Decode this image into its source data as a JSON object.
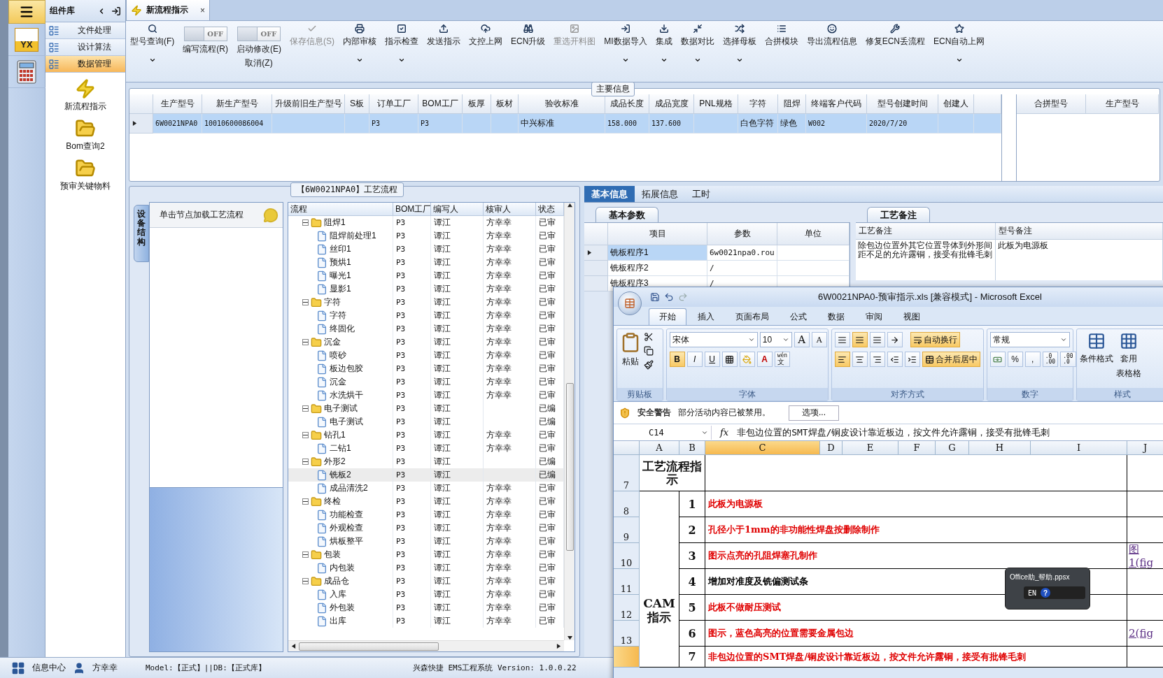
{
  "rail": {
    "logo_text": "YX"
  },
  "component_panel": {
    "title": "组件库",
    "menu": [
      {
        "label": "文件处理",
        "selected": false
      },
      {
        "label": "设计算法",
        "selected": false
      },
      {
        "label": "数据管理",
        "selected": true
      }
    ],
    "items": [
      {
        "kind": "action",
        "label": "新流程指示"
      },
      {
        "kind": "folder",
        "label": "Bom查询2"
      },
      {
        "kind": "folder",
        "label": "预审关键物料"
      }
    ]
  },
  "document_tab": {
    "label": "新流程指示",
    "close": "×"
  },
  "toolbar": [
    {
      "kind": "button",
      "label": "型号查询(F)",
      "dropdown": true,
      "disabled": false
    },
    {
      "kind": "toggle",
      "label": "编写流程(R)",
      "on": false,
      "state_text": "OFF"
    },
    {
      "kind": "toggle",
      "label": "启动修改(E)",
      "sublabel": "取消(Z)",
      "on": false,
      "state_text": "OFF"
    },
    {
      "kind": "button",
      "label": "保存信息(S)",
      "dropdown": false,
      "disabled": true
    },
    {
      "kind": "button",
      "label": "内部审核",
      "dropdown": true,
      "disabled": false
    },
    {
      "kind": "button",
      "label": "指示检查",
      "dropdown": true,
      "disabled": false
    },
    {
      "kind": "button",
      "label": "发送指示",
      "dropdown": false,
      "disabled": false
    },
    {
      "kind": "button",
      "label": "文控上网",
      "dropdown": false,
      "disabled": false
    },
    {
      "kind": "button",
      "label": "ECN升级",
      "dropdown": false,
      "disabled": false
    },
    {
      "kind": "button",
      "label": "重选开料图",
      "dropdown": false,
      "disabled": true
    },
    {
      "kind": "button",
      "label": "MI数据导入",
      "dropdown": true,
      "disabled": false
    },
    {
      "kind": "button",
      "label": "集成",
      "dropdown": true,
      "disabled": false
    },
    {
      "kind": "button",
      "label": "数据对比",
      "dropdown": true,
      "disabled": false
    },
    {
      "kind": "button",
      "label": "选择母板",
      "dropdown": true,
      "disabled": false
    },
    {
      "kind": "button",
      "label": "合拼模块",
      "dropdown": false,
      "disabled": false
    },
    {
      "kind": "button",
      "label": "导出流程信息",
      "dropdown": false,
      "disabled": false
    },
    {
      "kind": "button",
      "label": "修复ECN丢流程",
      "dropdown": false,
      "disabled": false
    },
    {
      "kind": "button",
      "label": "ECN自动上网",
      "dropdown": true,
      "disabled": false
    }
  ],
  "main_info": {
    "title": "主要信息",
    "columns": [
      "生产型号",
      "新生产型号",
      "升级前旧生产型号",
      "S板",
      "订单工厂",
      "BOM工厂",
      "板厚",
      "板材",
      "验收标准",
      "成品长度",
      "成品宽度",
      "PNL规格",
      "字符",
      "阻焊",
      "终端客户代码",
      "型号创建时间",
      "创建人"
    ],
    "rows": [
      {
        "selected": true,
        "cells": [
          "6W0021NPA0",
          "10010600086004",
          null,
          null,
          "P3",
          "P3",
          null,
          null,
          "中兴标准",
          "158.000",
          "137.600",
          null,
          "白色字符",
          "绿色",
          "W002",
          "2020/7/20",
          null
        ]
      }
    ],
    "merge_columns": [
      "合拼型号",
      "生产型号"
    ]
  },
  "process": {
    "title": "【6W0021NPA0】工艺流程",
    "side_tab": "设备结构",
    "hint": "单击节点加载工艺流程",
    "columns": [
      "流程",
      "BOM工厂",
      "编写人",
      "核审人",
      "状态"
    ],
    "tree": [
      {
        "name": "阻焊1",
        "bom": "P3",
        "writer": "谭江",
        "reviewer": "方幸幸",
        "status": "已审",
        "selected": false,
        "expanded": true,
        "children": [
          {
            "name": "阻焊前处理1",
            "bom": "P3",
            "writer": "谭江",
            "reviewer": "方幸幸",
            "status": "已审",
            "selected": false
          },
          {
            "name": "丝印1",
            "bom": "P3",
            "writer": "谭江",
            "reviewer": "方幸幸",
            "status": "已审",
            "selected": false
          },
          {
            "name": "预烘1",
            "bom": "P3",
            "writer": "谭江",
            "reviewer": "方幸幸",
            "status": "已审",
            "selected": false
          },
          {
            "name": "曝光1",
            "bom": "P3",
            "writer": "谭江",
            "reviewer": "方幸幸",
            "status": "已审",
            "selected": false
          },
          {
            "name": "显影1",
            "bom": "P3",
            "writer": "谭江",
            "reviewer": "方幸幸",
            "status": "已审",
            "selected": false
          }
        ]
      },
      {
        "name": "字符",
        "bom": "P3",
        "writer": "谭江",
        "reviewer": "方幸幸",
        "status": "已审",
        "selected": false,
        "expanded": true,
        "children": [
          {
            "name": "字符",
            "bom": "P3",
            "writer": "谭江",
            "reviewer": "方幸幸",
            "status": "已审",
            "selected": false
          },
          {
            "name": "终固化",
            "bom": "P3",
            "writer": "谭江",
            "reviewer": "方幸幸",
            "status": "已审",
            "selected": false
          }
        ]
      },
      {
        "name": "沉金",
        "bom": "P3",
        "writer": "谭江",
        "reviewer": "方幸幸",
        "status": "已审",
        "selected": false,
        "expanded": true,
        "children": [
          {
            "name": "喷砂",
            "bom": "P3",
            "writer": "谭江",
            "reviewer": "方幸幸",
            "status": "已审",
            "selected": false
          },
          {
            "name": "板边包胶",
            "bom": "P3",
            "writer": "谭江",
            "reviewer": "方幸幸",
            "status": "已审",
            "selected": false
          },
          {
            "name": "沉金",
            "bom": "P3",
            "writer": "谭江",
            "reviewer": "方幸幸",
            "status": "已审",
            "selected": false
          },
          {
            "name": "水洗烘干",
            "bom": "P3",
            "writer": "谭江",
            "reviewer": "方幸幸",
            "status": "已审",
            "selected": false
          }
        ]
      },
      {
        "name": "电子测试",
        "bom": "P3",
        "writer": "谭江",
        "status": "已编",
        "selected": false,
        "expanded": true,
        "children": [
          {
            "name": "电子测试",
            "bom": "P3",
            "writer": "谭江",
            "status": "已编",
            "selected": false
          }
        ]
      },
      {
        "name": "钻孔1",
        "bom": "P3",
        "writer": "谭江",
        "reviewer": "方幸幸",
        "status": "已审",
        "selected": false,
        "expanded": true,
        "children": [
          {
            "name": "二钻1",
            "bom": "P3",
            "writer": "谭江",
            "reviewer": "方幸幸",
            "status": "已审",
            "selected": false
          }
        ]
      },
      {
        "name": "外形2",
        "bom": "P3",
        "writer": "谭江",
        "status": "已编",
        "selected": false,
        "expanded": true,
        "children": [
          {
            "name": "铣板2",
            "bom": "P3",
            "writer": "谭江",
            "status": "已编",
            "selected": true
          },
          {
            "name": "成品清洗2",
            "bom": "P3",
            "writer": "谭江",
            "reviewer": "方幸幸",
            "status": "已审",
            "selected": false
          }
        ]
      },
      {
        "name": "终检",
        "bom": "P3",
        "writer": "谭江",
        "reviewer": "方幸幸",
        "status": "已审",
        "selected": false,
        "expanded": true,
        "children": [
          {
            "name": "功能检查",
            "bom": "P3",
            "writer": "谭江",
            "reviewer": "方幸幸",
            "status": "已审",
            "selected": false
          },
          {
            "name": "外观检查",
            "bom": "P3",
            "writer": "谭江",
            "reviewer": "方幸幸",
            "status": "已审",
            "selected": false
          },
          {
            "name": "烘板整平",
            "bom": "P3",
            "writer": "谭江",
            "reviewer": "方幸幸",
            "status": "已审",
            "selected": false
          }
        ]
      },
      {
        "name": "包装",
        "bom": "P3",
        "writer": "谭江",
        "reviewer": "方幸幸",
        "status": "已审",
        "selected": false,
        "expanded": true,
        "children": [
          {
            "name": "内包装",
            "bom": "P3",
            "writer": "谭江",
            "reviewer": "方幸幸",
            "status": "已审",
            "selected": false
          }
        ]
      },
      {
        "name": "成品仓",
        "bom": "P3",
        "writer": "谭江",
        "reviewer": "方幸幸",
        "status": "已审",
        "selected": false,
        "expanded": true,
        "children": [
          {
            "name": "入库",
            "bom": "P3",
            "writer": "谭江",
            "reviewer": "方幸幸",
            "status": "已审",
            "selected": false
          },
          {
            "name": "外包装",
            "bom": "P3",
            "writer": "谭江",
            "reviewer": "方幸幸",
            "status": "已审",
            "selected": false
          },
          {
            "name": "出库",
            "bom": "P3",
            "writer": "谭江",
            "reviewer": "方幸幸",
            "status": "已审",
            "selected": false
          }
        ]
      }
    ]
  },
  "detail": {
    "tabs": [
      {
        "label": "基本信息",
        "selected": true
      },
      {
        "label": "拓展信息",
        "selected": false
      },
      {
        "label": "工时",
        "selected": false
      }
    ],
    "params": {
      "title": "基本参数",
      "columns": [
        "项目",
        "参数",
        "单位"
      ],
      "rows": [
        {
          "item": "铣板程序1",
          "value": "6w0021npa0.rou",
          "selected": true
        },
        {
          "item": "铣板程序2",
          "value": "/",
          "selected": false
        },
        {
          "item": "铣板程序3",
          "value": "/",
          "selected": false
        }
      ]
    },
    "notes": {
      "title": "工艺备注",
      "columns": [
        "工艺备注",
        "型号备注"
      ],
      "process_note": "除包边位置外其它位置导体到外形间距不足的允许露铜，接受有批锋毛刺",
      "model_note": "此板为电源板"
    }
  },
  "excel": {
    "title": "6W0021NPA0-预审指示.xls  [兼容模式] - Microsoft Excel",
    "tabs": [
      {
        "label": "开始",
        "selected": true
      },
      {
        "label": "插入",
        "selected": false
      },
      {
        "label": "页面布局",
        "selected": false
      },
      {
        "label": "公式",
        "selected": false
      },
      {
        "label": "数据",
        "selected": false
      },
      {
        "label": "审阅",
        "selected": false
      },
      {
        "label": "视图",
        "selected": false
      }
    ],
    "clipboard": {
      "paste": "粘贴",
      "group": "剪贴板"
    },
    "font": {
      "name": "宋体",
      "size": "10",
      "grow": "A",
      "shrink": "A",
      "bold": "B",
      "italic": "I",
      "underline": "U",
      "font_color_letter": "A",
      "pinyin": "wén",
      "phonetic": "文",
      "group": "字体"
    },
    "alignment": {
      "wrap": "自动换行",
      "merge": "合并后居中",
      "group": "对齐方式"
    },
    "number": {
      "format": "常规",
      "percent": "%",
      "comma": ",",
      "decimals": [
        {
          "top": ".0",
          "bottom": ".00"
        },
        {
          "top": ".00",
          "bottom": ".0"
        }
      ],
      "group": "数字"
    },
    "styles": {
      "conditional": "条件格式",
      "table_lines": [
        "套用",
        "表格格"
      ],
      "group": "样式"
    },
    "security": {
      "title": "安全警告",
      "message": "部分活动内容已被禁用。",
      "button": "选项..."
    },
    "formula": {
      "cell": "C14",
      "fx": "fx",
      "content": "非包边位置的SMT焊盘/铜皮设计靠近板边，按文件允许露铜，接受有批锋毛刺"
    },
    "columns": [
      {
        "label": "A",
        "selected": false
      },
      {
        "label": "B",
        "selected": false
      },
      {
        "label": "C",
        "selected": true
      },
      {
        "label": "D",
        "selected": false
      },
      {
        "label": "E",
        "selected": false
      },
      {
        "label": "F",
        "selected": false
      },
      {
        "label": "G",
        "selected": false
      },
      {
        "label": "H",
        "selected": false
      },
      {
        "label": "I",
        "selected": false
      },
      {
        "label": "J",
        "selected": false
      }
    ],
    "header_row": {
      "row": "7",
      "title": "工艺流程指示"
    },
    "group_label": [
      "CAM",
      "指示"
    ],
    "rows": [
      {
        "row": "8",
        "index": "1",
        "text": "此板为电源板",
        "color": "#e00000",
        "selected": false
      },
      {
        "row": "9",
        "index": "2",
        "text": "孔径小于1mm的非功能性焊盘按删除制作",
        "color": "#e00000",
        "selected": false
      },
      {
        "row": "10",
        "index": "3",
        "text": "图示点亮的孔阻焊塞孔制作",
        "color": "#e00000",
        "selected": false,
        "link": [
          "图",
          "1(fig"
        ]
      },
      {
        "row": "11",
        "index": "4",
        "text": "增加对准度及铣偏测试条",
        "color": "#000000",
        "selected": false
      },
      {
        "row": "12",
        "index": "5",
        "text": "此板不做耐压测试",
        "color": "#e00000",
        "selected": false
      },
      {
        "row": "13",
        "index": "6",
        "text": "图示，蓝色高亮的位置需要金属包边",
        "color": "#e00000",
        "selected": false,
        "link": [
          "2(fig"
        ]
      },
      {
        "index": "7",
        "text": "非包边位置的SMT焊盘/铜皮设计靠近板边，按文件允许露铜，接受有批锋毛刺",
        "color": "#e00000",
        "selected": true
      }
    ]
  },
  "help_popup": {
    "title": "Office助_帮助.ppsx",
    "language": "EN",
    "help": "?"
  },
  "status_bar": {
    "info": "信息中心",
    "user": "方幸幸",
    "model": "Model:【正式】||DB:【正式库】",
    "product": "兴森快捷 EMS工程系统 Version: 1.0.0.22"
  }
}
